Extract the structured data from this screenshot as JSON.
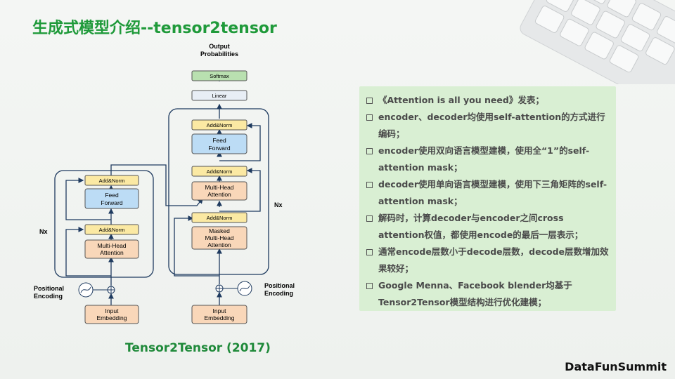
{
  "slide": {
    "title": "生成式模型介绍--tensor2tensor",
    "caption": "Tensor2Tensor (2017)",
    "logo": "DataFunSummit"
  },
  "diagram": {
    "output_label_1": "Output",
    "output_label_2": "Probabilities",
    "softmax": "Softmax",
    "linear": "Linear",
    "add_norm": "Add&Norm",
    "feed_1": "Feed",
    "feed_2": "Forward",
    "mha_1": "Multi-Head",
    "mha_2": "Attention",
    "masked_1": "Masked",
    "masked_2": "Multi-Head",
    "masked_3": "Attention",
    "nx": "Nx",
    "pos_1": "Positional",
    "pos_2": "Encoding",
    "input_1": "Input",
    "input_2": "Embedding"
  },
  "bullets": [
    "《Attention is all you need》发表；",
    "encoder、decoder均使用self-attention的方式进行编码；",
    "encoder使用双向语言模型建模，使用全“1”的self-attention mask；",
    "decoder使用单向语言模型建模，使用下三角矩阵的self-attention mask；",
    "解码时，计算decoder与encoder之间cross attention权值，都使用encode的最后一层表示；",
    "通常encode层数小于decode层数，decode层数增加效果较好；",
    "Google Menna、Facebook blender均基于Tensor2Tensor模型结构进行优化建模；"
  ],
  "colors": {
    "title": "#1f9a3a",
    "panel": "#d9efd3",
    "softmax": "#b9e0b0",
    "add_norm": "#fbe9a3",
    "feed": "#bcdcf5",
    "attention": "#f9d7b9",
    "input": "#f9d7b9"
  }
}
